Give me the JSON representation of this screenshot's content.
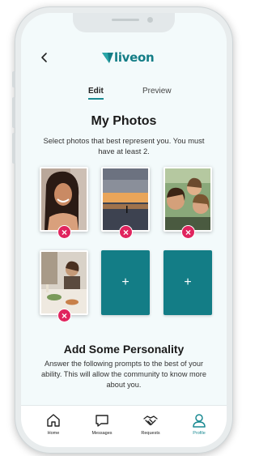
{
  "header": {
    "back_icon": "chevron-left-icon",
    "logo_text": "liveon",
    "brand_color": "#137d86"
  },
  "tabs": [
    {
      "label": "Edit",
      "active": true
    },
    {
      "label": "Preview",
      "active": false
    }
  ],
  "photos_section": {
    "title": "My Photos",
    "subtitle": "Select photos that best represent you. You must have at least 2.",
    "photos": [
      {
        "subject": "smiling woman",
        "remove_icon": "close-icon"
      },
      {
        "subject": "sunset beach paddleboard",
        "remove_icon": "close-icon"
      },
      {
        "subject": "group selfie",
        "remove_icon": "close-icon"
      },
      {
        "subject": "people at dinner table",
        "remove_icon": "close-icon"
      }
    ],
    "add_slots": [
      {
        "label": "+"
      },
      {
        "label": "+"
      }
    ]
  },
  "personality_section": {
    "title": "Add Some Personality",
    "text": "Answer the following prompts to the best of your ability. This will allow the community to know more about you."
  },
  "bottom_nav": [
    {
      "label": "Home",
      "icon": "home-icon",
      "active": false
    },
    {
      "label": "Messages",
      "icon": "message-icon",
      "active": false
    },
    {
      "label": "Requests",
      "icon": "handshake-icon",
      "active": false
    },
    {
      "label": "Profile",
      "icon": "profile-icon",
      "active": true
    }
  ],
  "colors": {
    "remove": "#e0245e",
    "accent": "#137d86",
    "background": "#f3fafb"
  }
}
